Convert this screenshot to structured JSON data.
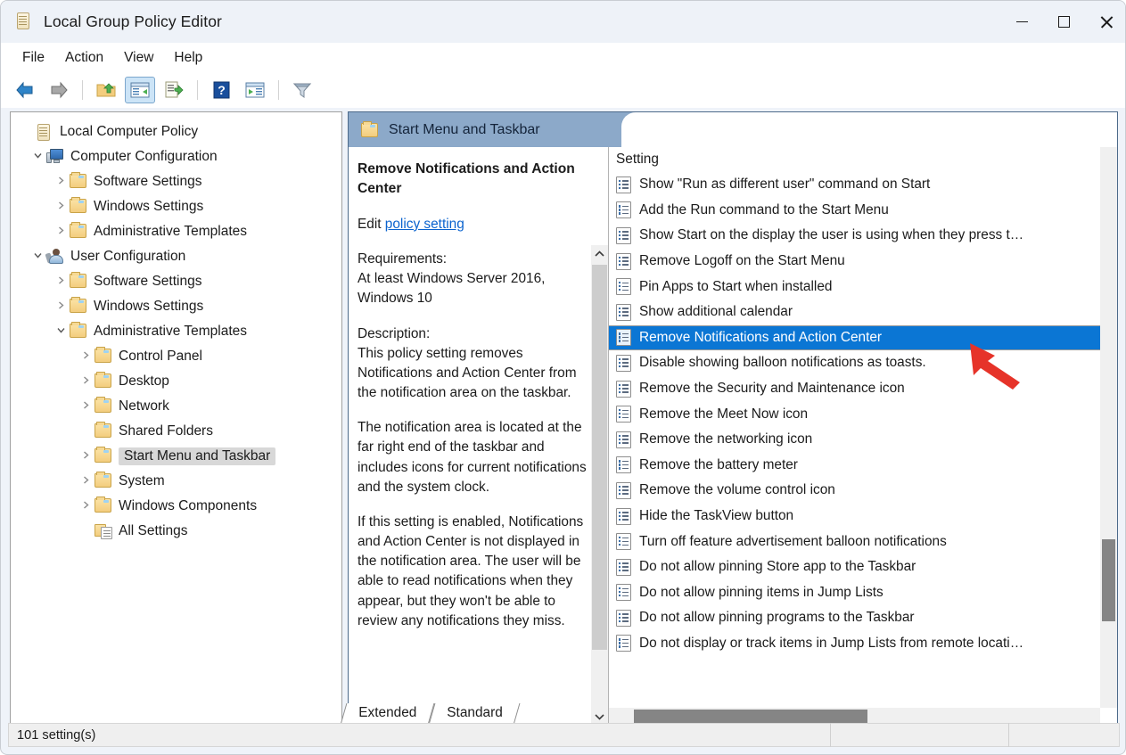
{
  "window": {
    "title": "Local Group Policy Editor",
    "icon": "policy-editor-icon",
    "minimize_label": "Minimize",
    "maximize_label": "Maximize",
    "close_label": "Close"
  },
  "menubar": {
    "items": [
      {
        "label": "File"
      },
      {
        "label": "Action"
      },
      {
        "label": "View"
      },
      {
        "label": "Help"
      }
    ]
  },
  "toolbar": {
    "buttons": [
      {
        "name": "back-button",
        "icon": "arrow-left-icon",
        "title": "Back"
      },
      {
        "name": "forward-button",
        "icon": "arrow-right-icon",
        "title": "Forward"
      },
      {
        "name": "up-one-level-button",
        "icon": "folder-up-icon",
        "title": "Up One Level"
      },
      {
        "name": "show-hide-tree-button",
        "icon": "tree-pane-icon",
        "title": "Show/Hide Console Tree",
        "active": true
      },
      {
        "name": "export-list-button",
        "icon": "export-list-icon",
        "title": "Export List"
      },
      {
        "name": "help-button",
        "icon": "question-mark-icon",
        "title": "Help"
      },
      {
        "name": "properties-button",
        "icon": "properties-icon",
        "title": "Properties"
      },
      {
        "name": "filter-button",
        "icon": "filter-funnel-icon",
        "title": "Filter Options"
      }
    ]
  },
  "tree": {
    "nodes": [
      {
        "label": "Local Computer Policy",
        "indent": 0,
        "twist": "",
        "icon": "policy-scroll-icon",
        "selected": false
      },
      {
        "label": "Computer Configuration",
        "indent": 1,
        "twist": "expanded",
        "icon": "computer-icon",
        "selected": false
      },
      {
        "label": "Software Settings",
        "indent": 2,
        "twist": "collapsed",
        "icon": "folder-icon",
        "selected": false
      },
      {
        "label": "Windows Settings",
        "indent": 2,
        "twist": "collapsed",
        "icon": "folder-icon",
        "selected": false
      },
      {
        "label": "Administrative Templates",
        "indent": 2,
        "twist": "collapsed",
        "icon": "folder-icon",
        "selected": false
      },
      {
        "label": "User Configuration",
        "indent": 1,
        "twist": "expanded",
        "icon": "user-icon",
        "selected": false
      },
      {
        "label": "Software Settings",
        "indent": 2,
        "twist": "collapsed",
        "icon": "folder-icon",
        "selected": false
      },
      {
        "label": "Windows Settings",
        "indent": 2,
        "twist": "collapsed",
        "icon": "folder-icon",
        "selected": false
      },
      {
        "label": "Administrative Templates",
        "indent": 2,
        "twist": "expanded",
        "icon": "folder-icon",
        "selected": false
      },
      {
        "label": "Control Panel",
        "indent": 3,
        "twist": "collapsed",
        "icon": "folder-icon",
        "selected": false
      },
      {
        "label": "Desktop",
        "indent": 3,
        "twist": "collapsed",
        "icon": "folder-icon",
        "selected": false
      },
      {
        "label": "Network",
        "indent": 3,
        "twist": "collapsed",
        "icon": "folder-icon",
        "selected": false
      },
      {
        "label": "Shared Folders",
        "indent": 3,
        "twist": "",
        "icon": "folder-icon",
        "selected": false
      },
      {
        "label": "Start Menu and Taskbar",
        "indent": 3,
        "twist": "collapsed",
        "icon": "folder-icon",
        "selected": true
      },
      {
        "label": "System",
        "indent": 3,
        "twist": "collapsed",
        "icon": "folder-icon",
        "selected": false
      },
      {
        "label": "Windows Components",
        "indent": 3,
        "twist": "collapsed",
        "icon": "folder-icon",
        "selected": false
      },
      {
        "label": "All Settings",
        "indent": 3,
        "twist": "",
        "icon": "all-settings-icon",
        "selected": false
      }
    ]
  },
  "panel": {
    "header_title": "Start Menu and Taskbar",
    "header_icon": "folder-icon",
    "header_color": "#8ca9c9"
  },
  "description": {
    "title": "Remove Notifications and Action Center",
    "edit_prefix": "Edit ",
    "edit_link": "policy setting",
    "requirements_label": "Requirements:",
    "requirements_value": "At least Windows Server 2016, Windows 10",
    "description_label": "Description:",
    "paragraphs": [
      "This policy setting removes Notifications and Action Center from the notification area on the taskbar.",
      "The notification area is located at the far right end of the taskbar and includes icons for current notifications and the system clock.",
      "If this setting is enabled, Notifications and Action Center is not displayed in the notification area. The user will be able to read notifications when they appear, but they won't be able to review any notifications they miss."
    ]
  },
  "settings_list": {
    "column_header": "Setting",
    "selected_index": 6,
    "rows": [
      {
        "label": "Show \"Run as different user\" command on Start"
      },
      {
        "label": "Add the Run command to the Start Menu"
      },
      {
        "label": "Show Start on the display the user is using when they press t…"
      },
      {
        "label": "Remove Logoff on the Start Menu"
      },
      {
        "label": "Pin Apps to Start when installed"
      },
      {
        "label": "Show additional calendar"
      },
      {
        "label": "Remove Notifications and Action Center"
      },
      {
        "label": "Disable showing balloon notifications as toasts."
      },
      {
        "label": "Remove the Security and Maintenance icon"
      },
      {
        "label": "Remove the Meet Now icon"
      },
      {
        "label": "Remove the networking icon"
      },
      {
        "label": "Remove the battery meter"
      },
      {
        "label": "Remove the volume control icon"
      },
      {
        "label": "Hide the TaskView button"
      },
      {
        "label": "Turn off feature advertisement balloon notifications"
      },
      {
        "label": "Do not allow pinning Store app to the Taskbar"
      },
      {
        "label": "Do not allow pinning items in Jump Lists"
      },
      {
        "label": "Do not allow pinning programs to the Taskbar"
      },
      {
        "label": "Do not display or track items in Jump Lists from remote locati…"
      }
    ]
  },
  "tabs": [
    {
      "label": "Extended",
      "active": false
    },
    {
      "label": "Standard",
      "active": true
    }
  ],
  "statusbar": {
    "count_text": "101 setting(s)",
    "cell2": "",
    "cell3": ""
  },
  "annotation": {
    "arrow_color": "#e63329",
    "name": "red-pointer-arrow"
  },
  "colors": {
    "selection_blue": "#0b76d4",
    "panel_header_blue": "#8ca9c9",
    "link_blue": "#0b63ce"
  }
}
